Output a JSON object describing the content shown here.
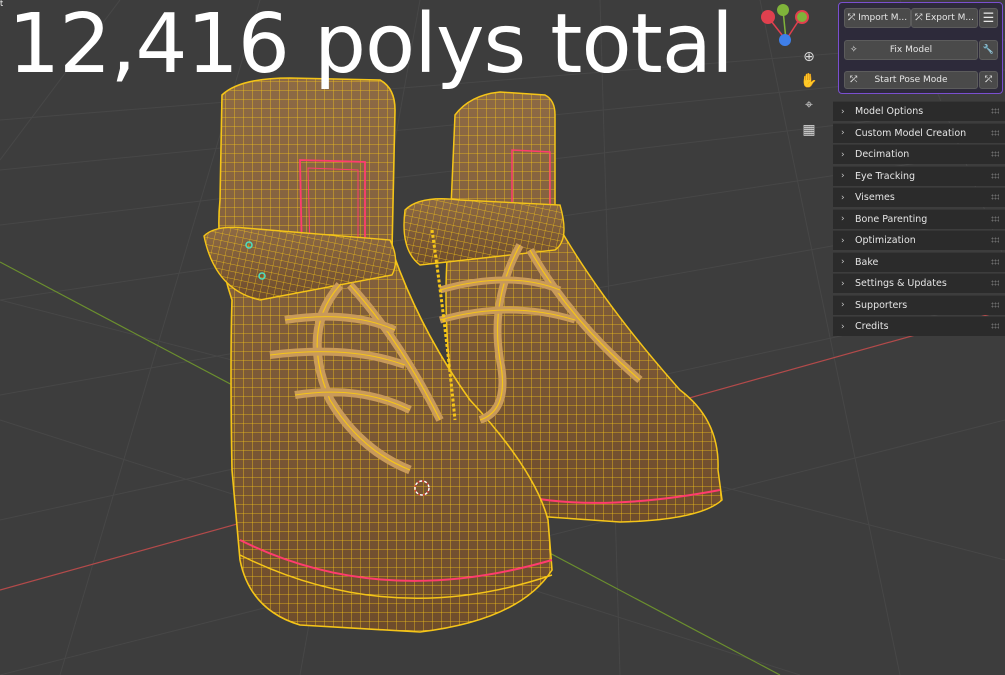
{
  "overlay": {
    "title": "12,416 polys total",
    "corner_mark": "t"
  },
  "viewport": {
    "grid_color": "#474747",
    "axis_x_color": "#b34a4a",
    "axis_y_color": "#6b8f2e",
    "mesh_fill": "#8a6238",
    "wire_color": "#f5c518",
    "seam_color": "#ff3c6e"
  },
  "gizmo": {
    "x_color": "#e0404e",
    "y_color": "#7fb33a",
    "z_color": "#3f7fe8",
    "icons": [
      "zoom-icon",
      "hand-pan-icon",
      "camera-icon",
      "grid-icon"
    ]
  },
  "panel": {
    "accent": "#7a4fd0",
    "import_label": "Import M...",
    "export_label": "Export M...",
    "menu_icon": "menu-icon",
    "fix_label": "Fix Model",
    "wrench_icon": "wrench-icon",
    "pose_label": "Start Pose Mode",
    "sections": [
      "Model Options",
      "Custom Model Creation",
      "Decimation",
      "Eye Tracking",
      "Visemes",
      "Bone Parenting",
      "Optimization",
      "Bake",
      "Settings & Updates",
      "Supporters",
      "Credits"
    ]
  }
}
